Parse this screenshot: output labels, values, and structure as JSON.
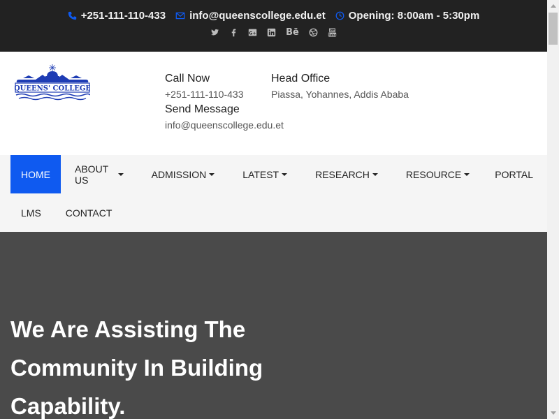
{
  "topbar": {
    "phone": "+251-111-110-433",
    "email": "info@queenscollege.edu.et",
    "opening": "Opening: 8:00am - 5:30pm",
    "social": [
      {
        "icon": "twitter-icon",
        "glyph": "t"
      },
      {
        "icon": "facebook-icon",
        "glyph": "f"
      },
      {
        "icon": "google-plus-icon",
        "glyph": "g"
      },
      {
        "icon": "linkedin-icon",
        "glyph": "in"
      },
      {
        "icon": "behance-icon",
        "glyph": "Bē"
      },
      {
        "icon": "dribbble-icon",
        "glyph": "◎"
      },
      {
        "icon": "youtube-icon",
        "glyph": "▶"
      }
    ]
  },
  "logo": {
    "text": "QUEENS' COLLEGE"
  },
  "header": {
    "call_title": "Call Now",
    "call_value": "+251-111-110-433",
    "office_title": "Head Office",
    "office_value": "Piassa, Yohannes, Addis Ababa",
    "message_title": "Send Message",
    "message_value": "info@queenscollege.edu.et"
  },
  "nav": {
    "items": [
      {
        "label": "HOME",
        "dropdown": false
      },
      {
        "label": "ABOUT US",
        "dropdown": true
      },
      {
        "label": "ADMISSION",
        "dropdown": true
      },
      {
        "label": "LATEST",
        "dropdown": true
      },
      {
        "label": "RESEARCH",
        "dropdown": true
      },
      {
        "label": "RESOURCE",
        "dropdown": true
      },
      {
        "label": "PORTAL",
        "dropdown": false
      },
      {
        "label": "LMS",
        "dropdown": false
      },
      {
        "label": "CONTACT",
        "dropdown": false
      }
    ]
  },
  "hero": {
    "headline": "We Are Assisting The Community In Building Capability."
  },
  "colors": {
    "accent": "#0f5af0",
    "topbar_bg": "#222222",
    "hero_bg": "#4a4a4a",
    "nav_bg": "#f5f5f5"
  }
}
